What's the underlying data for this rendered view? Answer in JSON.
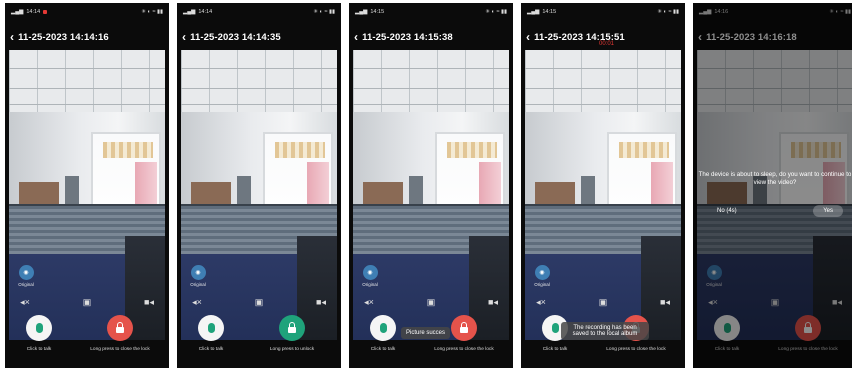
{
  "status": {
    "time": "14:14",
    "indicators": "✳ ◐ ≈ ▮▮"
  },
  "frames": [
    {
      "timestamp": "11-25-2023 14:14:16",
      "status_time": "14:14"
    },
    {
      "timestamp": "11-25-2023 14:14:35",
      "status_time": "14:14"
    },
    {
      "timestamp": "11-25-2023 14:15:38",
      "status_time": "14:15"
    },
    {
      "timestamp": "11-25-2023 14:15:51",
      "status_time": "14:15",
      "rec_time": "00:01"
    },
    {
      "timestamp": "11-25-2023 14:16:18",
      "status_time": "14:16"
    }
  ],
  "original_label": "Original",
  "talk_label": "Click to talk",
  "lock_label_close": "Long press to close the lock",
  "lock_label_unlock": "Long press to unlock",
  "toast_picture": "Picture succes",
  "toast_recording": "The recording has been saved to the local album",
  "dialog": {
    "text": "The device is about to sleep, do you want to continue to view the video?",
    "no": "No (4s)",
    "yes": "Yes"
  },
  "colors": {
    "lock_red": "#e5534b",
    "unlock_green": "#1fa37b",
    "rec_red": "#e53935"
  }
}
